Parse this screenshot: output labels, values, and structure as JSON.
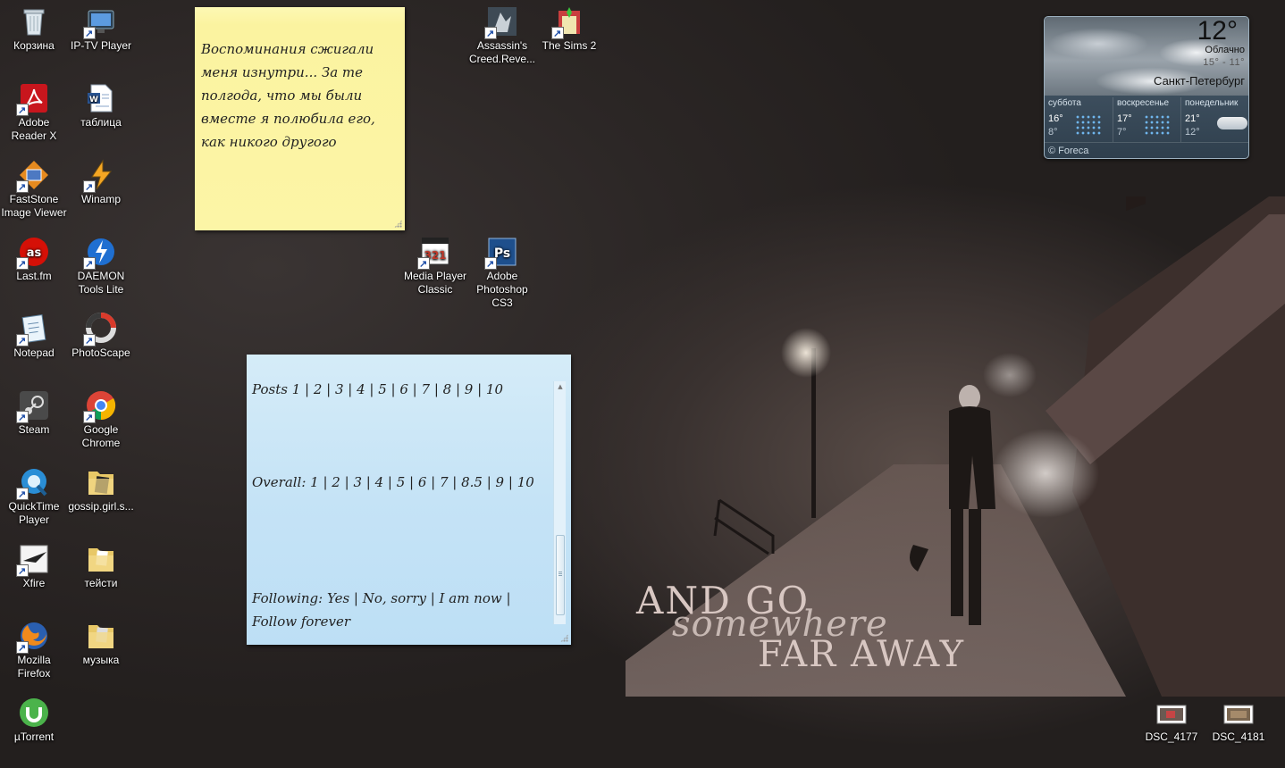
{
  "desktop_icons": {
    "recycle_bin": "Корзина",
    "iptv": "IP-TV Player",
    "acrobat": "Adobe Reader X",
    "tablica": "таблица",
    "faststone": "FastStone Image Viewer",
    "winamp": "Winamp",
    "lastfm": "Last.fm",
    "daemon": "DAEMON Tools Lite",
    "notepad": "Notepad",
    "photoscape": "PhotoScape",
    "steam": "Steam",
    "chrome": "Google Chrome",
    "quicktime": "QuickTime Player",
    "gossip": "gossip.girl.s...",
    "xfire": "Xfire",
    "teisti": "тейсти",
    "firefox": "Mozilla Firefox",
    "muzyka": "музыка",
    "utorrent": "µTorrent",
    "assassins": "Assassin's Creed.Reve...",
    "sims": "The Sims 2",
    "mpc": "Media Player Classic",
    "photoshop": "Adobe Photoshop CS3",
    "dsc4177": "DSC_4177",
    "dsc4181": "DSC_4181"
  },
  "sticky_yellow": {
    "text": "Воспоминания сжигали меня изнутри... За те полгода, что мы были вместе я полюбила его, как никого другого"
  },
  "sticky_blue": {
    "posts": "Posts 1 | 2 | 3 | 4 | 5 | 6 | 7 | 8 | 9 | 10",
    "overall": "Overall: 1 | 2 | 3 | 4 | 5 | 6 | 7 | 8.5 | 9 | 10",
    "following": "Following: Yes | No, sorry | I am now | Follow forever"
  },
  "weather": {
    "temperature": "12°",
    "condition": "Облачно",
    "range": "15° - 11°",
    "city": "Санкт-Петербург",
    "forecast": [
      {
        "day": "суббота",
        "high": "16°",
        "low": "8°",
        "icon": "rain-icon"
      },
      {
        "day": "воскресенье",
        "high": "17°",
        "low": "7°",
        "icon": "rain-icon"
      },
      {
        "day": "понедельник",
        "high": "21°",
        "low": "12°",
        "icon": "cloud-icon"
      }
    ],
    "credit": "© Foreca"
  },
  "wallpaper": {
    "line1": "AND GO",
    "line2": "somewhere",
    "line3": "FAR AWAY"
  },
  "colors": {
    "sticky_yellow": "#fcf5a6",
    "sticky_blue": "#c5e3f6",
    "desktop_bg": "#2b2625"
  }
}
